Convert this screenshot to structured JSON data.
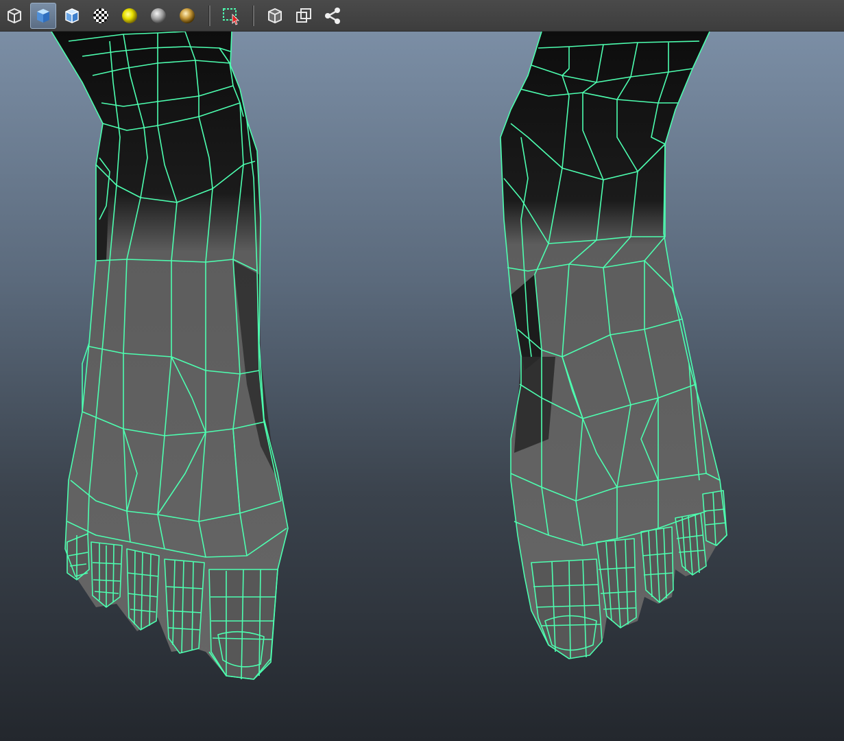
{
  "toolbar": {
    "buttons": [
      {
        "icon": "wireframe-cube-icon",
        "active": false
      },
      {
        "icon": "smooth-shade-cube-icon",
        "active": true
      },
      {
        "icon": "shade-wireframe-cube-icon",
        "active": false
      },
      {
        "icon": "checker-texture-icon",
        "active": false
      },
      {
        "icon": "default-light-icon",
        "active": false
      },
      {
        "icon": "shadows-sphere-icon",
        "active": false
      },
      {
        "icon": "lit-sphere-icon",
        "active": false
      },
      {
        "icon": "select-highlight-icon",
        "active": false
      },
      {
        "icon": "isolate-cube-icon",
        "active": false
      },
      {
        "icon": "xray-icon",
        "active": false
      },
      {
        "icon": "share-nodes-icon",
        "active": false
      }
    ]
  },
  "colors": {
    "wire": "#4dffb0",
    "skin_light": "#5e5e5e",
    "skin_dark": "#151515",
    "sky_top": "#7b8ea5",
    "sky_bottom": "#23272d"
  }
}
